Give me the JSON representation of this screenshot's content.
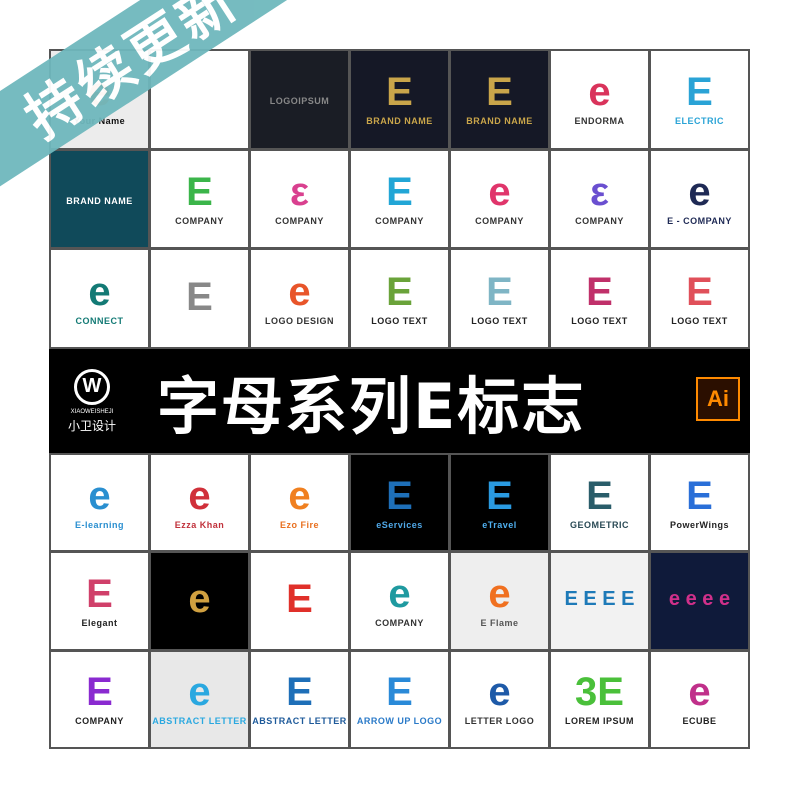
{
  "top_tiles": [
    {
      "glyph": "e",
      "caption": "Your Name",
      "bg": "#ececec",
      "fg": "#e8742a",
      "cc": "#111"
    },
    {
      "glyph": "",
      "caption": "",
      "bg": "#ffffff",
      "fg": "#222",
      "cc": "#222"
    },
    {
      "glyph": "",
      "caption": "LOGOIPSUM",
      "bg": "#1a1d25",
      "fg": "#c9a54a",
      "cc": "#888"
    },
    {
      "glyph": "E",
      "caption": "BRAND NAME",
      "bg": "#151826",
      "fg": "#c9a54a",
      "cc": "#c9a54a"
    },
    {
      "glyph": "E",
      "caption": "BRAND NAME",
      "bg": "#151826",
      "fg": "#c9a54a",
      "cc": "#c9a54a"
    },
    {
      "glyph": "e",
      "caption": "ENDORMA",
      "bg": "#ffffff",
      "fg": "#d9335b",
      "cc": "#333"
    },
    {
      "glyph": "E",
      "caption": "ELECTRIC",
      "bg": "#ffffff",
      "fg": "#2aa3d6",
      "cc": "#2aa3d6"
    },
    {
      "glyph": "",
      "caption": "BRAND NAME",
      "bg": "#104a5a",
      "fg": "#fff",
      "cc": "#fff"
    },
    {
      "glyph": "E",
      "caption": "COMPANY",
      "bg": "#ffffff",
      "fg": "#3bb54a",
      "cc": "#333"
    },
    {
      "glyph": "ε",
      "caption": "COMPANY",
      "bg": "#ffffff",
      "fg": "#d9408f",
      "cc": "#333"
    },
    {
      "glyph": "E",
      "caption": "COMPANY",
      "bg": "#ffffff",
      "fg": "#22a6d6",
      "cc": "#333"
    },
    {
      "glyph": "e",
      "caption": "COMPANY",
      "bg": "#ffffff",
      "fg": "#e0356b",
      "cc": "#333"
    },
    {
      "glyph": "ε",
      "caption": "COMPANY",
      "bg": "#ffffff",
      "fg": "#6a4fd0",
      "cc": "#333"
    },
    {
      "glyph": "e",
      "caption": "E - COMPANY",
      "bg": "#ffffff",
      "fg": "#1f2a55",
      "cc": "#1f2a55"
    },
    {
      "glyph": "e",
      "caption": "CONNECT",
      "bg": "#ffffff",
      "fg": "#137a75",
      "cc": "#137a75"
    },
    {
      "glyph": "E",
      "caption": "",
      "bg": "#ffffff",
      "fg": "#888",
      "cc": "#333"
    },
    {
      "glyph": "e",
      "caption": "LOGO DESIGN",
      "bg": "#ffffff",
      "fg": "#e8552a",
      "cc": "#333"
    },
    {
      "glyph": "E",
      "caption": "LOGO TEXT",
      "bg": "#ffffff",
      "fg": "#6aa33a",
      "cc": "#222"
    },
    {
      "glyph": "E",
      "caption": "LOGO TEXT",
      "bg": "#ffffff",
      "fg": "#7fb5c5",
      "cc": "#222"
    },
    {
      "glyph": "E",
      "caption": "LOGO TEXT",
      "bg": "#ffffff",
      "fg": "#c0306a",
      "cc": "#222"
    },
    {
      "glyph": "E",
      "caption": "LOGO TEXT",
      "bg": "#ffffff",
      "fg": "#e0505a",
      "cc": "#222"
    }
  ],
  "bottom_tiles": [
    {
      "glyph": "e",
      "caption": "E-learning",
      "bg": "#ffffff",
      "fg": "#2a8fd0",
      "cc": "#2a8fd0"
    },
    {
      "glyph": "e",
      "caption": "Ezza Khan",
      "bg": "#ffffff",
      "fg": "#d0303a",
      "cc": "#c0303a"
    },
    {
      "glyph": "e",
      "caption": "Ezo Fire",
      "bg": "#ffffff",
      "fg": "#f08020",
      "cc": "#e87020"
    },
    {
      "glyph": "E",
      "caption": "eServices",
      "bg": "#000000",
      "fg": "#1e6fb8",
      "cc": "#4fa8e8"
    },
    {
      "glyph": "E",
      "caption": "eTravel",
      "bg": "#000000",
      "fg": "#2a9ae0",
      "cc": "#4fb0f0"
    },
    {
      "glyph": "E",
      "caption": "GEOMETRIC",
      "bg": "#ffffff",
      "fg": "#2a5d6a",
      "cc": "#2a4a55"
    },
    {
      "glyph": "E",
      "caption": "PowerWings",
      "bg": "#ffffff",
      "fg": "#2a6fd8",
      "cc": "#222"
    },
    {
      "glyph": "E",
      "caption": "Elegant",
      "bg": "#ffffff",
      "fg": "#d0406a",
      "cc": "#222"
    },
    {
      "glyph": "e",
      "caption": "",
      "bg": "#000000",
      "fg": "#d0a040",
      "cc": "#fff"
    },
    {
      "glyph": "E",
      "caption": "",
      "bg": "#ffffff",
      "fg": "#e0302a",
      "cc": "#222"
    },
    {
      "glyph": "e",
      "caption": "COMPANY",
      "bg": "#ffffff",
      "fg": "#1f9aa0",
      "cc": "#333"
    },
    {
      "glyph": "e",
      "caption": "E Flame",
      "bg": "#eeeeee",
      "fg": "#f07020",
      "cc": "#555"
    },
    {
      "glyph": "E E E E",
      "caption": "",
      "bg": "#f2f2f2",
      "fg": "#1e7ab8",
      "cc": "#333"
    },
    {
      "glyph": "e e e e",
      "caption": "",
      "bg": "#0f1a3a",
      "fg": "#d0308a",
      "cc": "#fff"
    },
    {
      "glyph": "E",
      "caption": "COMPANY",
      "bg": "#ffffff",
      "fg": "#8a2ad0",
      "cc": "#222"
    },
    {
      "glyph": "e",
      "caption": "ABSTRACT LETTER",
      "bg": "#e8e8e8",
      "fg": "#2aa8e0",
      "cc": "#2aa8e0"
    },
    {
      "glyph": "E",
      "caption": "ABSTRACT LETTER",
      "bg": "#ffffff",
      "fg": "#1e6fb8",
      "cc": "#1e5a9a"
    },
    {
      "glyph": "E",
      "caption": "ARROW UP LOGO",
      "bg": "#ffffff",
      "fg": "#2a8ad8",
      "cc": "#2a7ac8"
    },
    {
      "glyph": "e",
      "caption": "LETTER LOGO",
      "bg": "#ffffff",
      "fg": "#1e5aa8",
      "cc": "#333"
    },
    {
      "glyph": "3E",
      "caption": "LOREM IPSUM",
      "bg": "#ffffff",
      "fg": "#4ac03a",
      "cc": "#222"
    },
    {
      "glyph": "e",
      "caption": "ECUBE",
      "bg": "#ffffff",
      "fg": "#c0308a",
      "cc": "#222"
    }
  ],
  "banner": {
    "brand_mark": "W",
    "brand_en": "XIAOWEISHEJI",
    "brand_cn": "小卫设计",
    "title": "字母系列E标志",
    "file_badge": "Ai"
  },
  "ribbon": {
    "text": "持续更新",
    "color": "#6fb8bd"
  }
}
